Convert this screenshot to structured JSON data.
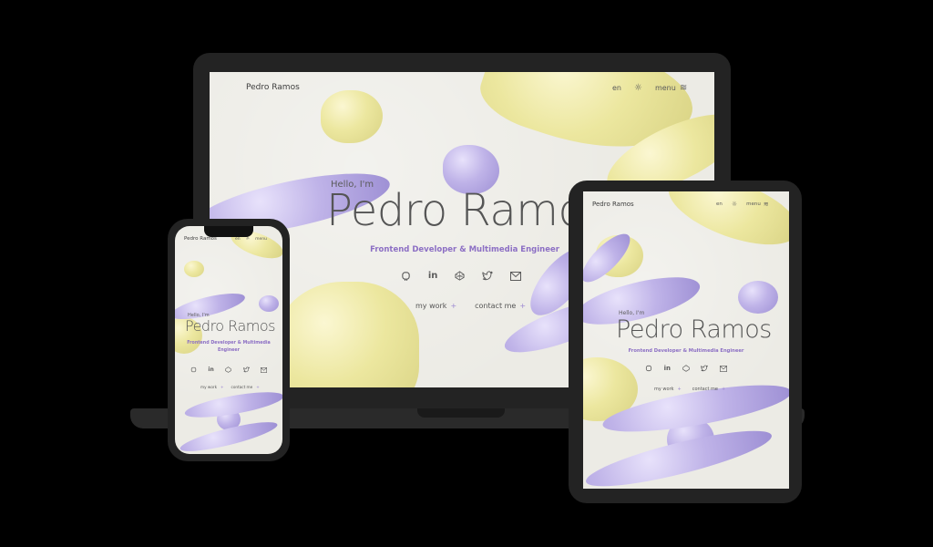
{
  "site": {
    "brand": "Pedro Ramos",
    "nav": {
      "lang": "en",
      "menu": "menu"
    },
    "hero": {
      "hello": "Hello, I'm",
      "name": "Pedro Ramos",
      "role": "Frontend Developer & Multimedia Engineer",
      "role_line1": "Frontend Developer & Multimedia",
      "role_line2": "Engineer"
    },
    "socials": [
      "github-icon",
      "linkedin-icon",
      "codepen-icon",
      "twitter-icon",
      "mail-icon"
    ],
    "ctas": {
      "work": "my work",
      "contact": "contact me",
      "plus": "+"
    }
  },
  "colors": {
    "background": "#000000",
    "screen": "#ecebe5",
    "accent": "#8c6fc4",
    "blob_yellow": "#ece79f",
    "blob_purple": "#bfb3e8",
    "device": "#232323"
  }
}
